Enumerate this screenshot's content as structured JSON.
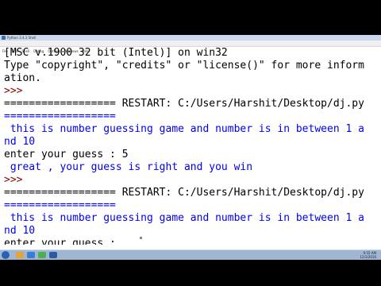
{
  "window": {
    "title": "Python 3.4.3 Shell",
    "menu": [
      "File",
      "Edit",
      "Shell",
      "Debug",
      "Options",
      "Windows",
      "Help"
    ]
  },
  "shell": {
    "lines": [
      {
        "text": "[MSC v.1900 32 bit (Intel)] on win32",
        "style": "out"
      },
      {
        "text": "Type \"copyright\", \"credits\" or \"license()\" for more inform",
        "style": "out"
      },
      {
        "text": "ation.",
        "style": "out"
      },
      {
        "text": ">>>",
        "style": "prompt"
      },
      {
        "text": "================== RESTART: C:/Users/Harshit/Desktop/dj.py",
        "style": "out"
      },
      {
        "text": "==================",
        "style": "blue"
      },
      {
        "text": " this is number guessing game and number is in between 1 a",
        "style": "blue"
      },
      {
        "text": "nd 10",
        "style": "blue"
      },
      {
        "text": "enter your guess : 5",
        "style": "out"
      },
      {
        "text": " great , your guess is right and you win",
        "style": "blue"
      },
      {
        "text": ">>>",
        "style": "prompt"
      },
      {
        "text": "================== RESTART: C:/Users/Harshit/Desktop/dj.py",
        "style": "out"
      },
      {
        "text": "==================",
        "style": "blue"
      },
      {
        "text": " this is number guessing game and number is in between 1 a",
        "style": "blue"
      },
      {
        "text": "nd 10",
        "style": "blue"
      },
      {
        "text": "enter your guess : ",
        "style": "out"
      }
    ]
  },
  "taskbar": {
    "time": "9:55 AM",
    "date": "12/1/2016",
    "app_colors": [
      "#e8a23a",
      "#3a7bd5",
      "#4caf50",
      "#2d5aa0"
    ]
  }
}
